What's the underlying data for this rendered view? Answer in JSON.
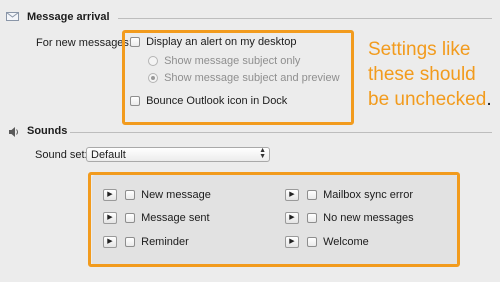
{
  "message_arrival": {
    "title": "Message arrival",
    "for_new_messages_label": "For new messages:",
    "display_alert": {
      "label": "Display an alert on my desktop",
      "checked": false
    },
    "show_subject_only": {
      "label": "Show message subject only",
      "selected": false
    },
    "show_subject_preview": {
      "label": "Show message subject and preview",
      "selected": true
    },
    "bounce_icon": {
      "label": "Bounce Outlook icon in Dock",
      "checked": false
    }
  },
  "callout": {
    "line1": "Settings like",
    "line2": "these should",
    "line3": "be unchecked",
    "period": "."
  },
  "sounds": {
    "title": "Sounds",
    "sound_set_label": "Sound set:",
    "sound_set_value": "Default",
    "items": [
      {
        "label": "New message",
        "checked": false
      },
      {
        "label": "Message sent",
        "checked": false
      },
      {
        "label": "Reminder",
        "checked": false
      },
      {
        "label": "Mailbox sync error",
        "checked": false
      },
      {
        "label": "No new messages",
        "checked": false
      },
      {
        "label": "Welcome",
        "checked": false
      }
    ]
  },
  "colors": {
    "annotation": "#f29b1d",
    "background": "#ececec"
  }
}
